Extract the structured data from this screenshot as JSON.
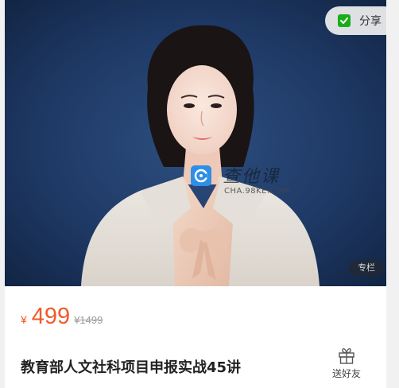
{
  "cover": {
    "share_label": "分享",
    "column_tag": "专栏",
    "watermark": {
      "cn": "查他课",
      "en": "CHA.98KE.COM"
    }
  },
  "product": {
    "price_symbol": "¥",
    "price": "499",
    "original_price": "¥1499",
    "title": "教育部人文社科项目申报实战45讲"
  },
  "actions": {
    "gift_label": "送好友"
  },
  "colors": {
    "price": "#f05a28",
    "cover_bg": "#1d3660",
    "share_icon": "#1aad19"
  },
  "icons": {
    "share": "wechat-share-icon",
    "gift": "gift-icon",
    "watermark_logo": "watermark-logo-icon"
  }
}
